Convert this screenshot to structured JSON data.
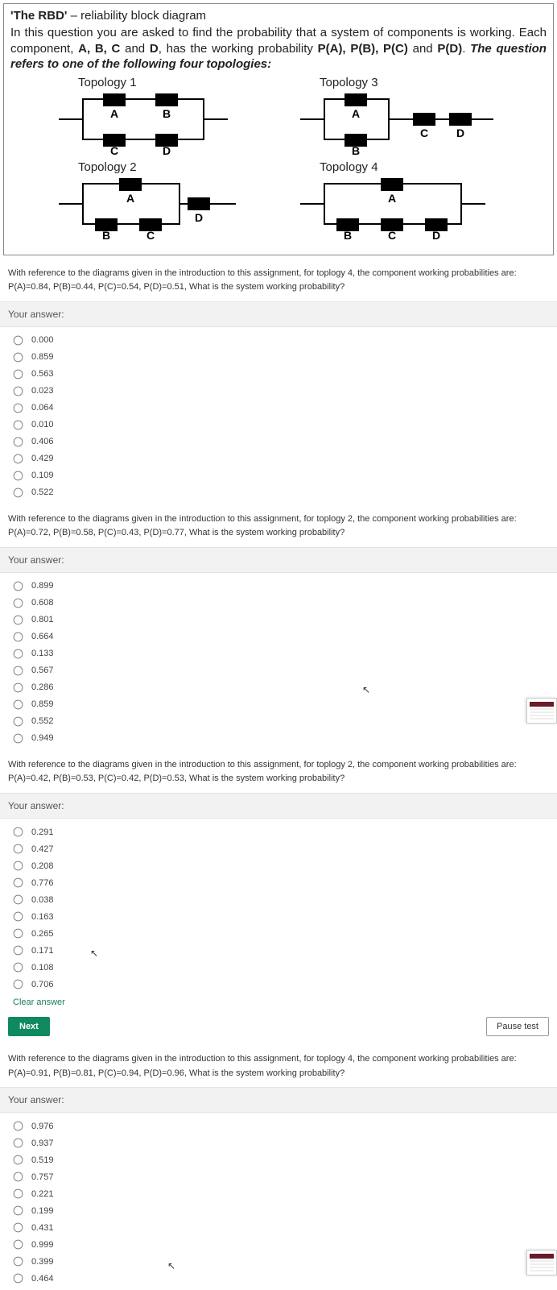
{
  "intro": {
    "title": "'The RBD'",
    "dash": " – reliability block diagram",
    "body_plain": "In this question you are asked to find the probability that a system of components is working. Each component, ",
    "bold1": "A, B, C",
    "body_plain2": " and ",
    "bold2": "D",
    "body_plain3": ", has the working probability ",
    "bold3": "P(A), P(B), P(C)",
    "body_plain4": " and ",
    "bold4": "P(D)",
    "body_plain5": ". ",
    "italic_tail": "The question refers to one of the following four topologies:",
    "topo1_label": "Topology 1",
    "topo2_label": "Topology 2",
    "topo3_label": "Topology 3",
    "topo4_label": "Topology 4",
    "labels": {
      "A": "A",
      "B": "B",
      "C": "C",
      "D": "D"
    }
  },
  "answer_header": "Your answer:",
  "clear_answer": "Clear answer",
  "next_btn": "Next",
  "pause_btn": "Pause test",
  "questions": [
    {
      "text": "With reference to the diagrams given in the introduction to this assignment, for toplogy 4, the component working probabilities are: P(A)=0.84, P(B)=0.44, P(C)=0.54, P(D)=0.51, What is the system working probability?",
      "options": [
        "0.000",
        "0.859",
        "0.563",
        "0.023",
        "0.064",
        "0.010",
        "0.406",
        "0.429",
        "0.109",
        "0.522"
      ]
    },
    {
      "text": "With reference to the diagrams given in the introduction to this assignment, for toplogy 2, the component working probabilities are: P(A)=0.72, P(B)=0.58, P(C)=0.43, P(D)=0.77, What is the system working probability?",
      "options": [
        "0.899",
        "0.608",
        "0.801",
        "0.664",
        "0.133",
        "0.567",
        "0.286",
        "0.859",
        "0.552",
        "0.949"
      ]
    },
    {
      "text": "With reference to the diagrams given in the introduction to this assignment, for toplogy 2, the component working probabilities are: P(A)=0.42, P(B)=0.53, P(C)=0.42, P(D)=0.53, What is the system working probability?",
      "options": [
        "0.291",
        "0.427",
        "0.208",
        "0.776",
        "0.038",
        "0.163",
        "0.265",
        "0.171",
        "0.108",
        "0.706"
      ]
    },
    {
      "text": "With reference to the diagrams given in the introduction to this assignment, for toplogy 4, the component working probabilities are: P(A)=0.91, P(B)=0.81, P(C)=0.94, P(D)=0.96, What is the system working probability?",
      "options": [
        "0.976",
        "0.937",
        "0.519",
        "0.757",
        "0.221",
        "0.199",
        "0.431",
        "0.999",
        "0.399",
        "0.464"
      ]
    }
  ]
}
